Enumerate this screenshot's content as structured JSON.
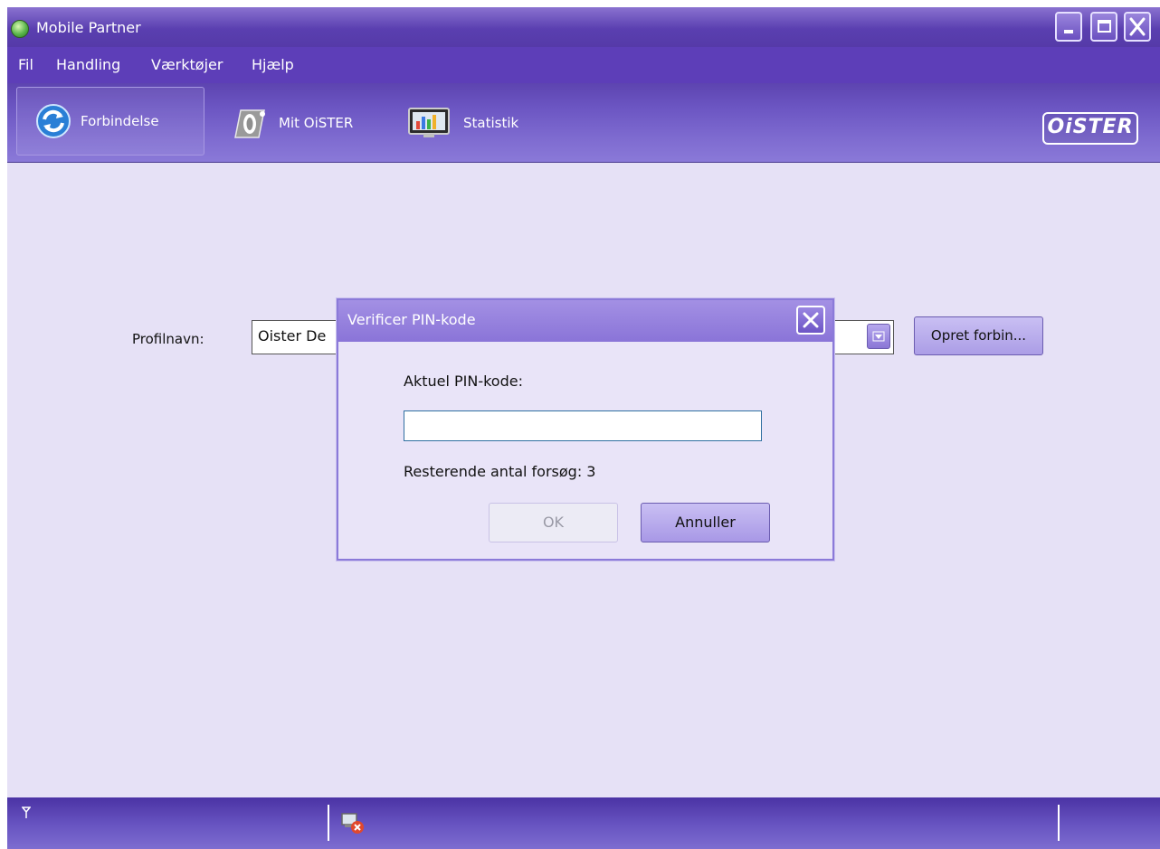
{
  "window": {
    "title": "Mobile Partner"
  },
  "menu": [
    "Fil",
    "Handling",
    "Værktøjer",
    "Hjælp"
  ],
  "toolbar": {
    "connection": "Forbindelse",
    "my_oister": "Mit OiSTER",
    "statistics": "Statistik",
    "logo": "OiSTER"
  },
  "profile": {
    "label": "Profilnavn:",
    "value": "Oister De",
    "connect_button": "Opret forbin..."
  },
  "dialog": {
    "title": "Verificer PIN-kode",
    "current_pin_label": "Aktuel PIN-kode:",
    "pin_value": "",
    "attempts_text": "Resterende antal forsøg: 3",
    "ok": "OK",
    "cancel": "Annuller"
  },
  "colors": {
    "titlebar": "#5a3fb0",
    "menubar": "#5d3eb8",
    "content_bg": "#e6e1f6",
    "accent": "#8b7ad9"
  },
  "icons": {
    "signal": "signal-antenna-icon",
    "network_status": "network-disconnected-icon"
  }
}
